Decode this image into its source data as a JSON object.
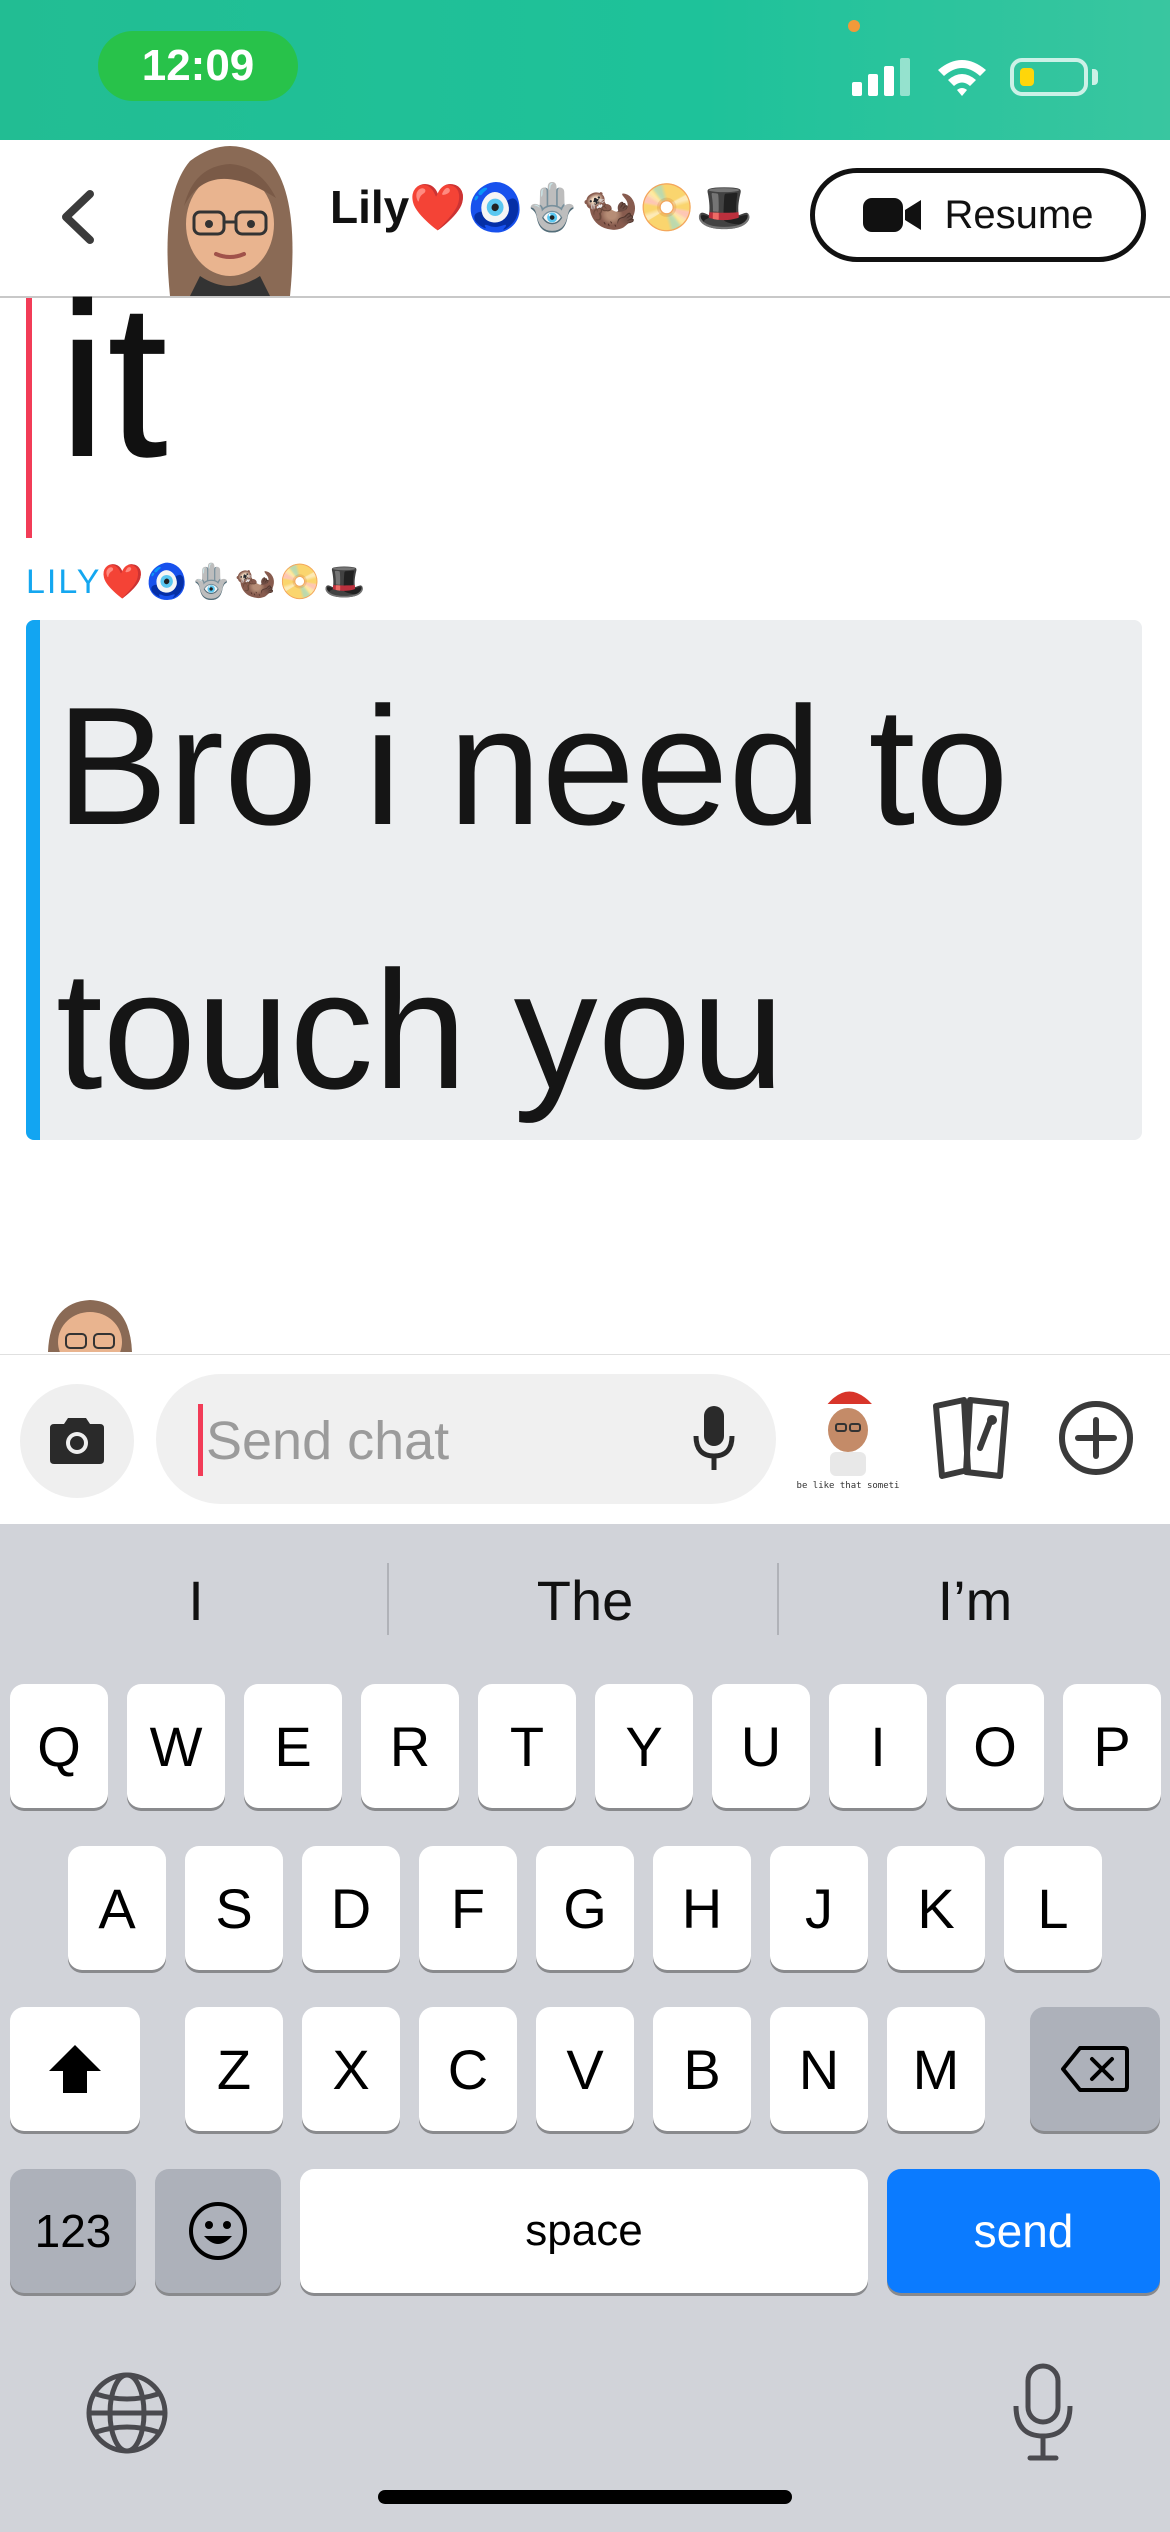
{
  "status_bar": {
    "time": "12:09"
  },
  "header": {
    "contact_name": "Lily❤️🧿🪬🦦📀🎩",
    "resume_label": "Resume"
  },
  "messages": {
    "previous_text_fragment": "it",
    "sender_label": "LILY❤️🧿🪬🦦📀🎩",
    "message_text": "Bro i need to touch you"
  },
  "input": {
    "placeholder": "Send chat",
    "bitmoji_caption": "It be like that sometimes"
  },
  "keyboard": {
    "suggestions": [
      "I",
      "The",
      "I’m"
    ],
    "row1": [
      "Q",
      "W",
      "E",
      "R",
      "T",
      "Y",
      "U",
      "I",
      "O",
      "P"
    ],
    "row2": [
      "A",
      "S",
      "D",
      "F",
      "G",
      "H",
      "J",
      "K",
      "L"
    ],
    "row3": [
      "Z",
      "X",
      "C",
      "V",
      "B",
      "N",
      "M"
    ],
    "numbers_label": "123",
    "space_label": "space",
    "send_label": "send"
  },
  "colors": {
    "status_bar": "#22bd93",
    "accent_blue": "#12a5f2",
    "accent_red": "#f23c57",
    "send_blue": "#0b7bff"
  },
  "icons": [
    "back-icon",
    "video-camera-icon",
    "camera-icon",
    "microphone-icon",
    "cards-icon",
    "plus-circle-icon",
    "shift-icon",
    "delete-icon",
    "emoji-icon",
    "globe-icon",
    "dictation-mic-icon"
  ]
}
